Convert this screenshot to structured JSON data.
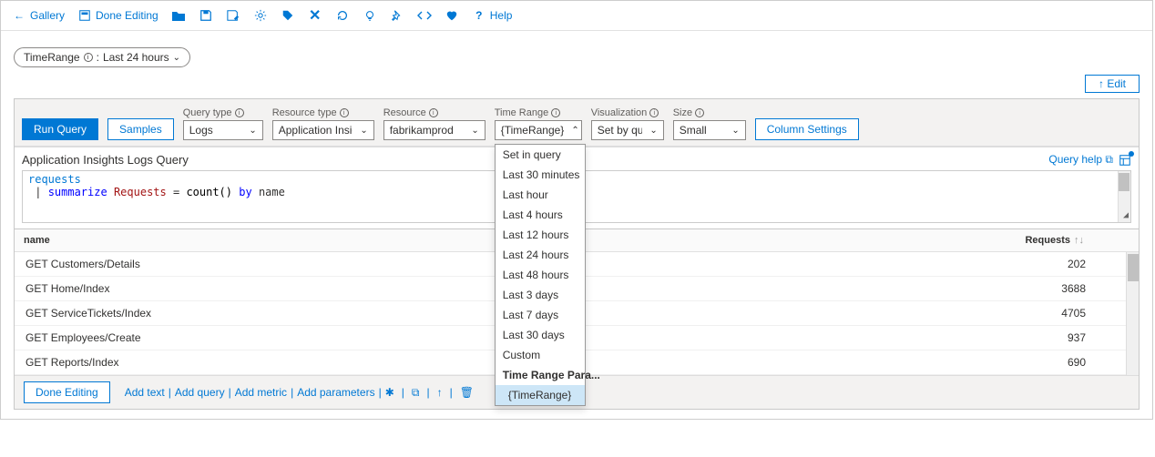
{
  "toolbar": {
    "gallery": "Gallery",
    "done_editing": "Done Editing",
    "help": "Help"
  },
  "param_pill": {
    "label": "TimeRange",
    "value": "Last 24 hours"
  },
  "edit_button": "↑ Edit",
  "query_panel": {
    "run_query": "Run Query",
    "samples": "Samples",
    "query_type_label": "Query type",
    "query_type_value": "Logs",
    "resource_type_label": "Resource type",
    "resource_type_value": "Application Insights",
    "resource_label": "Resource",
    "resource_value": "fabrikamprod",
    "time_range_label": "Time Range",
    "time_range_value": "{TimeRange}",
    "visualization_label": "Visualization",
    "visualization_value": "Set by query",
    "size_label": "Size",
    "size_value": "Small",
    "column_settings": "Column Settings",
    "time_range_options": [
      "Set in query",
      "Last 30 minutes",
      "Last hour",
      "Last 4 hours",
      "Last 12 hours",
      "Last 24 hours",
      "Last 48 hours",
      "Last 3 days",
      "Last 7 days",
      "Last 30 days",
      "Custom"
    ],
    "time_range_param_header": "Time Range Para...",
    "time_range_param_selected": "{TimeRange}"
  },
  "query_area": {
    "title": "Application Insights Logs Query",
    "help_link": "Query help",
    "code_line1": "requests",
    "code_kw1": "summarize",
    "code_ident": "Requests",
    "code_eq": " = ",
    "code_fn": "count()",
    "code_kw2": "by",
    "code_name": "name"
  },
  "results": {
    "col_name": "name",
    "col_requests": "Requests",
    "rows": [
      {
        "name": "GET Customers/Details",
        "requests": "202"
      },
      {
        "name": "GET Home/Index",
        "requests": "3688"
      },
      {
        "name": "GET ServiceTickets/Index",
        "requests": "4705"
      },
      {
        "name": "GET Employees/Create",
        "requests": "937"
      },
      {
        "name": "GET Reports/Index",
        "requests": "690"
      }
    ]
  },
  "footer": {
    "done_editing": "Done Editing",
    "add_text": "Add text",
    "add_query": "Add query",
    "add_metric": "Add metric",
    "add_parameters": "Add parameters"
  }
}
